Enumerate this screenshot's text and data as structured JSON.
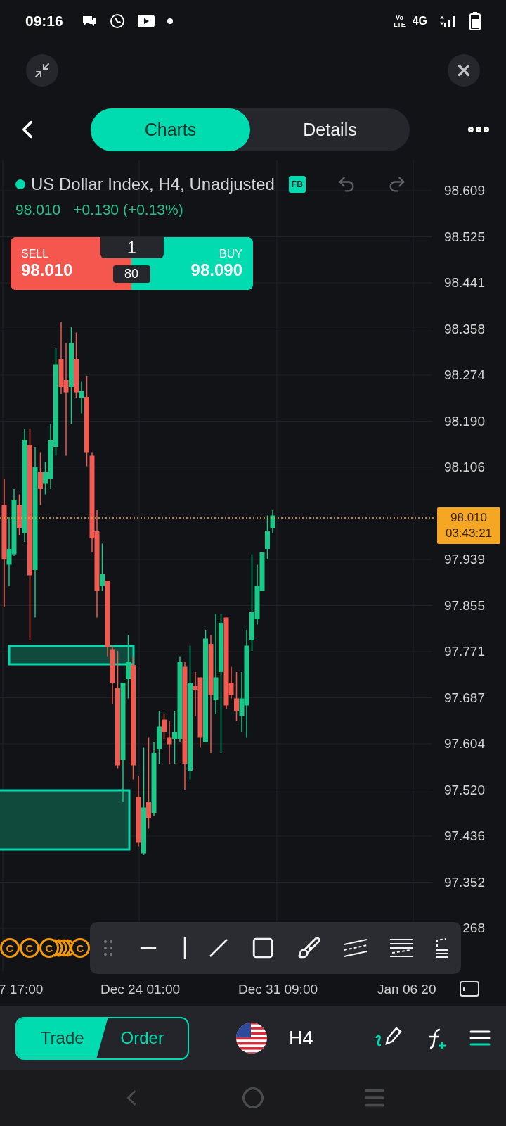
{
  "status_bar": {
    "time": "09:16",
    "volte_lines": [
      "Vo",
      "LTE"
    ],
    "network": "4G"
  },
  "tabs": [
    {
      "label": "Charts",
      "selected": true
    },
    {
      "label": "Details",
      "selected": false
    }
  ],
  "instrument": {
    "title": "US Dollar Index, H4, Unadjusted",
    "badge": "FB",
    "price": "98.010",
    "change": "+0.130 (+0.13%)"
  },
  "trade_widget": {
    "sell_label": "SELL",
    "sell_price": "98.010",
    "buy_label": "BUY",
    "buy_price": "98.090",
    "quantity": "1",
    "spread": "80"
  },
  "y_axis": [
    "98.609",
    "98.525",
    "98.441",
    "98.358",
    "98.274",
    "98.190",
    "98.106",
    "97.939",
    "97.855",
    "97.771",
    "97.687",
    "97.604",
    "97.520",
    "97.436",
    "97.352",
    "268"
  ],
  "current_price": {
    "price": "98.010",
    "countdown": "03:43:21"
  },
  "markers": [
    "C",
    "C",
    "C",
    "C"
  ],
  "x_axis": [
    "7 17:00",
    "Dec 24 01:00",
    "Dec 31 09:00",
    "Jan 06 20"
  ],
  "bottom_bar": {
    "modes": [
      {
        "label": "Trade",
        "selected": true
      },
      {
        "label": "Order",
        "selected": false
      }
    ],
    "timeframe": "H4"
  }
}
